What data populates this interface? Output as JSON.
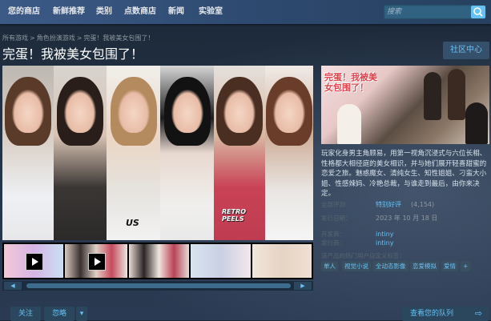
{
  "nav": {
    "items": [
      "您的商店",
      "新鲜推荐",
      "类别",
      "点数商店",
      "新闻",
      "实验室"
    ],
    "search_placeholder": "搜索"
  },
  "breadcrumb": [
    "所有游戏",
    "角色扮演游戏",
    "完蛋！我被美女包围了！"
  ],
  "breadcrumb_sep": ">",
  "title": "完蛋！我被美女包围了！",
  "community_button": "社区中心",
  "media": {
    "shirt_texts": [
      "US",
      "RETRO PEELS"
    ],
    "thumbnails": [
      {
        "type": "video"
      },
      {
        "type": "video"
      },
      {
        "type": "image"
      },
      {
        "type": "image"
      },
      {
        "type": "image"
      }
    ]
  },
  "capsule_title": "完蛋！我被美女包围了！",
  "description": "玩家化身男主角顾易，用第一视角沉浸式与六位长相、性格都大相径庭的美女相识，并与她们展开轻喜甜蜜的恋爱之旅。魅惑魔女、清纯女生、知性姐姐、刁蛮大小姐、性感辣妈、冷艳总裁，与谁走到最后，由你来决定。",
  "reviews": {
    "label": "全部评测",
    "summary": "特别好评",
    "count": "(4,154)"
  },
  "release": {
    "label": "发行日期：",
    "date": "2023 年 10 月 18 日"
  },
  "developer": {
    "label": "开发商：",
    "name": "intiny"
  },
  "publisher": {
    "label": "发行商：",
    "name": "intiny"
  },
  "tags_label": "该产品的热门用户自定义标签：",
  "tags": [
    "单人",
    "视觉小说",
    "全动态影像",
    "恋爱模拟",
    "爱情",
    "+"
  ],
  "bottom": {
    "follow": "关注",
    "ignore": "忽略",
    "dropdown": "▾",
    "queue": "查看您的队列",
    "queue_arrow": "⇨"
  },
  "colors": {
    "accent": "#67c1f5",
    "nav_bg": "#3b5a86",
    "page_bg": "#1b2838"
  },
  "icons": {
    "search": "magnifier",
    "play": "play-triangle"
  }
}
